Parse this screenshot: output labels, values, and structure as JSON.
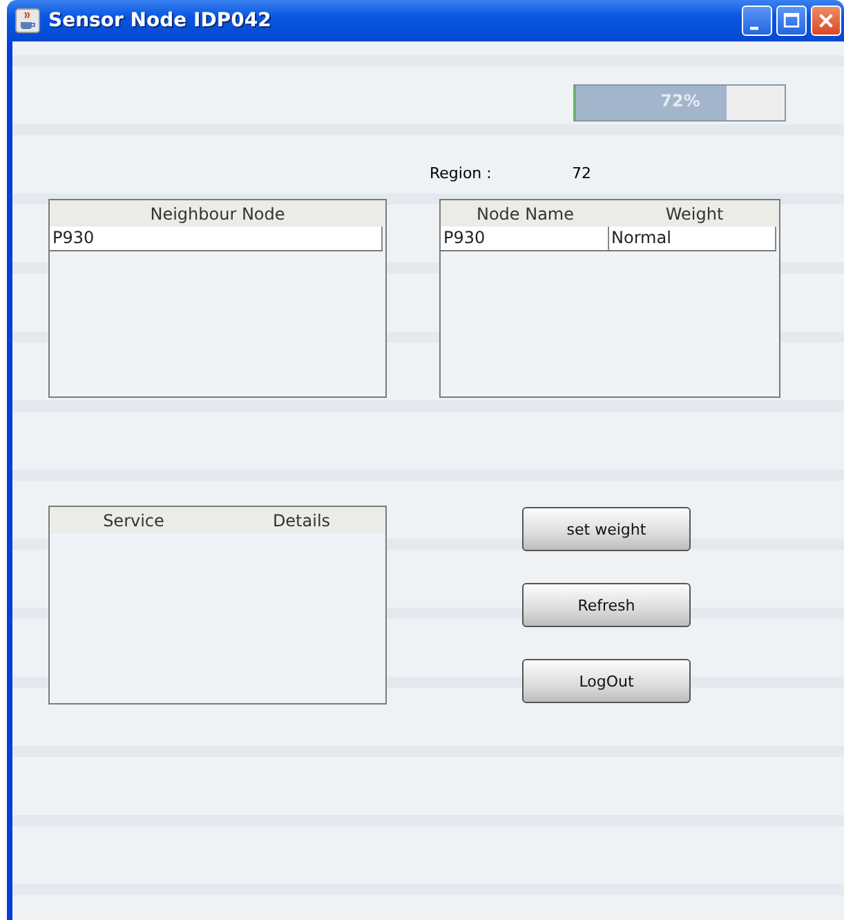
{
  "window": {
    "title": "Sensor Node IDP042"
  },
  "progress": {
    "level": 0.72,
    "label": "72%"
  },
  "region": {
    "label": "Region :",
    "value": "72"
  },
  "neighbour_table": {
    "columns": [
      "Neighbour Node"
    ],
    "rows": [
      [
        "P930"
      ]
    ]
  },
  "node_table": {
    "columns": [
      "Node Name",
      "Weight"
    ],
    "rows": [
      [
        "P930",
        "Normal"
      ]
    ]
  },
  "service_table": {
    "columns": [
      "Service",
      "Details"
    ]
  },
  "buttons": [
    "set weight",
    "Refresh",
    "LogOut"
  ]
}
